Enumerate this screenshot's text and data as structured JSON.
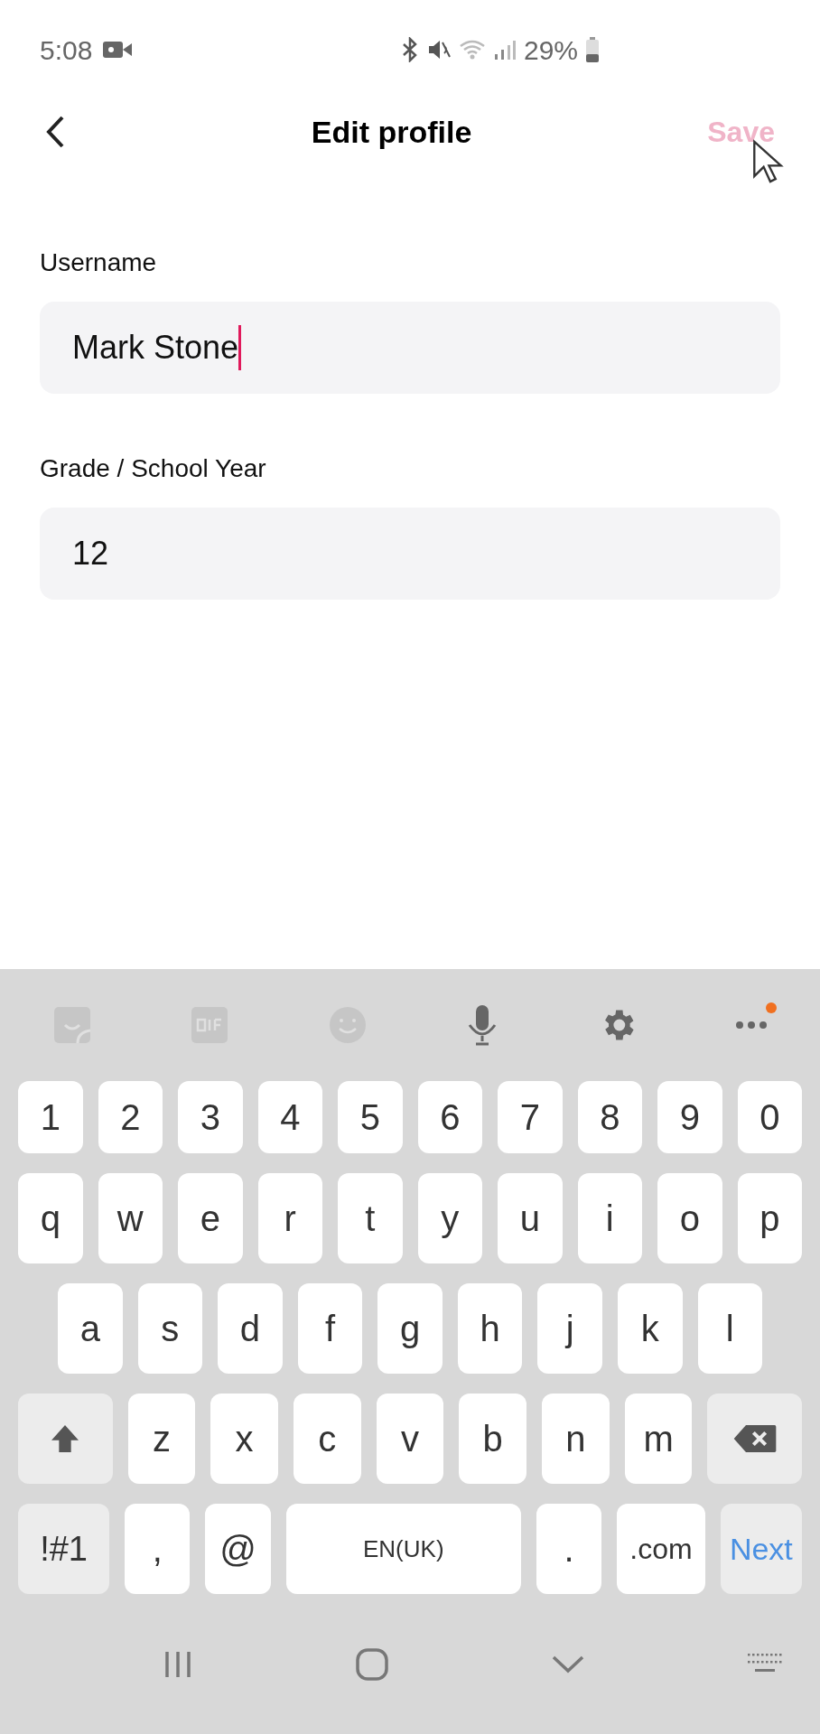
{
  "status_bar": {
    "time": "5:08",
    "battery": "29%"
  },
  "header": {
    "title": "Edit profile",
    "save": {
      "label": "Save",
      "disabled": true
    }
  },
  "fields": [
    {
      "label": "Username",
      "value": "Mark Stone",
      "focused": true
    },
    {
      "label": "Grade / School Year",
      "value": "12",
      "focused": false
    }
  ],
  "keyboard": {
    "more_badge": true,
    "rows": [
      {
        "keys": [
          {
            "kind": "char",
            "label": "1"
          },
          {
            "kind": "char",
            "label": "2"
          },
          {
            "kind": "char",
            "label": "3"
          },
          {
            "kind": "char",
            "label": "4"
          },
          {
            "kind": "char",
            "label": "5"
          },
          {
            "kind": "char",
            "label": "6"
          },
          {
            "kind": "char",
            "label": "7"
          },
          {
            "kind": "char",
            "label": "8"
          },
          {
            "kind": "char",
            "label": "9"
          },
          {
            "kind": "char",
            "label": "0"
          }
        ]
      },
      {
        "keys": [
          {
            "kind": "char",
            "label": "q"
          },
          {
            "kind": "char",
            "label": "w"
          },
          {
            "kind": "char",
            "label": "e"
          },
          {
            "kind": "char",
            "label": "r"
          },
          {
            "kind": "char",
            "label": "t"
          },
          {
            "kind": "char",
            "label": "y"
          },
          {
            "kind": "char",
            "label": "u"
          },
          {
            "kind": "char",
            "label": "i"
          },
          {
            "kind": "char",
            "label": "o"
          },
          {
            "kind": "char",
            "label": "p"
          }
        ]
      },
      {
        "keys": [
          {
            "kind": "char",
            "label": "a"
          },
          {
            "kind": "char",
            "label": "s"
          },
          {
            "kind": "char",
            "label": "d"
          },
          {
            "kind": "char",
            "label": "f"
          },
          {
            "kind": "char",
            "label": "g"
          },
          {
            "kind": "char",
            "label": "h"
          },
          {
            "kind": "char",
            "label": "j"
          },
          {
            "kind": "char",
            "label": "k"
          },
          {
            "kind": "char",
            "label": "l"
          }
        ]
      },
      {
        "keys": [
          {
            "kind": "shift"
          },
          {
            "kind": "char",
            "label": "z"
          },
          {
            "kind": "char",
            "label": "x"
          },
          {
            "kind": "char",
            "label": "c"
          },
          {
            "kind": "char",
            "label": "v"
          },
          {
            "kind": "char",
            "label": "b"
          },
          {
            "kind": "char",
            "label": "n"
          },
          {
            "kind": "char",
            "label": "m"
          },
          {
            "kind": "backspace"
          }
        ]
      },
      {
        "keys": [
          {
            "kind": "symbols",
            "label": "!#1"
          },
          {
            "kind": "char",
            "label": ","
          },
          {
            "kind": "char",
            "label": "@"
          },
          {
            "kind": "space",
            "label": "EN(UK)"
          },
          {
            "kind": "char",
            "label": "."
          },
          {
            "kind": "domain",
            "label": ".com"
          },
          {
            "kind": "action",
            "label": "Next"
          }
        ]
      }
    ]
  }
}
